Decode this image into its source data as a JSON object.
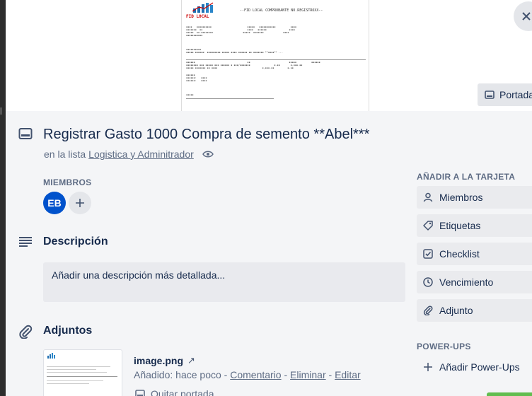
{
  "cover": {
    "doc_brand": "FID LOCAL",
    "doc_heading": "--FID LOCAL COMPROBANTE NO.REGISTROXX--",
    "button_label": "Portada"
  },
  "card": {
    "title": "Registrar Gasto 1000 Compra de semento **Abel***",
    "list_prefix": "en la lista",
    "list_name": "Logistica y Adminitrador"
  },
  "members": {
    "heading": "MIEMBROS",
    "avatar_initials": "EB"
  },
  "description": {
    "heading": "Descripción",
    "placeholder": "Añadir una descripción más detallada..."
  },
  "attachments": {
    "heading": "Adjuntos",
    "items": [
      {
        "name": "image.png",
        "added": "Añadido: hace poco",
        "actions": [
          "Comentario",
          "Eliminar",
          "Editar"
        ],
        "remove_cover": "Quitar portada"
      }
    ]
  },
  "sidebar": {
    "add_heading": "AÑADIR A LA TARJETA",
    "add_items": [
      {
        "label": "Miembros",
        "icon": "person-icon"
      },
      {
        "label": "Etiquetas",
        "icon": "tag-icon"
      },
      {
        "label": "Checklist",
        "icon": "checkbox-icon"
      },
      {
        "label": "Vencimiento",
        "icon": "clock-icon"
      },
      {
        "label": "Adjunto",
        "icon": "paperclip-icon"
      }
    ],
    "powerups_heading": "POWER-UPS",
    "powerups_add": "Añadir Power-Ups"
  }
}
